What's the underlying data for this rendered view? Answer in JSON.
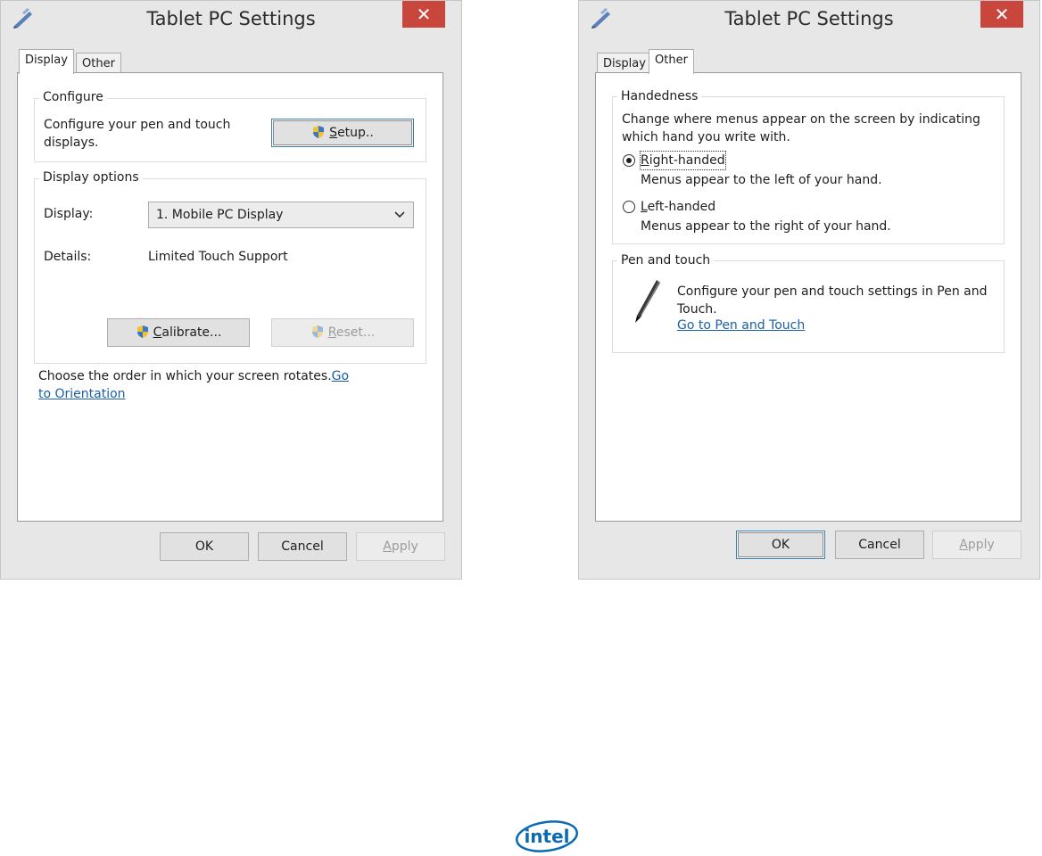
{
  "dialog_left": {
    "title": "Tablet PC Settings",
    "close_glyph": "✕",
    "tabs": [
      {
        "label": "Display",
        "active": true
      },
      {
        "label": "Other",
        "active": false
      }
    ],
    "configure": {
      "group_label": "Configure",
      "text_line1": "Configure your pen and touch",
      "text_line2": "displays.",
      "setup_button_mnemonic": "S",
      "setup_button_rest": "etup..",
      "setup_icon": "uac-shield-icon"
    },
    "display_options": {
      "group_label": "Display options",
      "display_label": "Display:",
      "display_value": "1. Mobile PC Display",
      "details_label": "Details:",
      "details_value": "Limited Touch Support",
      "calibrate_mnemonic": "C",
      "calibrate_rest": "alibrate...",
      "reset_mnemonic": "R",
      "reset_rest": "eset..."
    },
    "orientation_text": "Choose the order in which your screen rotates.",
    "orientation_link_part1": "Go",
    "orientation_link_part2": "to Orientation",
    "buttons": {
      "ok": "OK",
      "cancel": "Cancel",
      "apply_mnemonic": "A",
      "apply_rest": "pply"
    }
  },
  "dialog_right": {
    "title": "Tablet PC Settings",
    "close_glyph": "✕",
    "tabs": [
      {
        "label": "Display",
        "active": false
      },
      {
        "label": "Other",
        "active": true
      }
    ],
    "handedness": {
      "group_label": "Handedness",
      "description_line1": "Change where menus appear on the screen by indicating",
      "description_line2": "which hand you write with.",
      "right_mnemonic": "R",
      "right_rest": "ight-handed",
      "right_desc": "Menus appear to the left of your hand.",
      "left_mnemonic": "L",
      "left_rest": "eft-handed",
      "left_desc": "Menus appear to the right of your hand.",
      "selected": "right"
    },
    "pen_touch": {
      "group_label": "Pen and touch",
      "text_line1": "Configure your pen and touch settings in Pen and",
      "text_line2": "Touch.",
      "link": "Go to Pen and Touch",
      "icon": "pen-icon"
    },
    "buttons": {
      "ok": "OK",
      "cancel": "Cancel",
      "apply_mnemonic": "A",
      "apply_rest": "pply"
    }
  },
  "logo": {
    "text": "intel",
    "color": "#0a6ab3"
  }
}
